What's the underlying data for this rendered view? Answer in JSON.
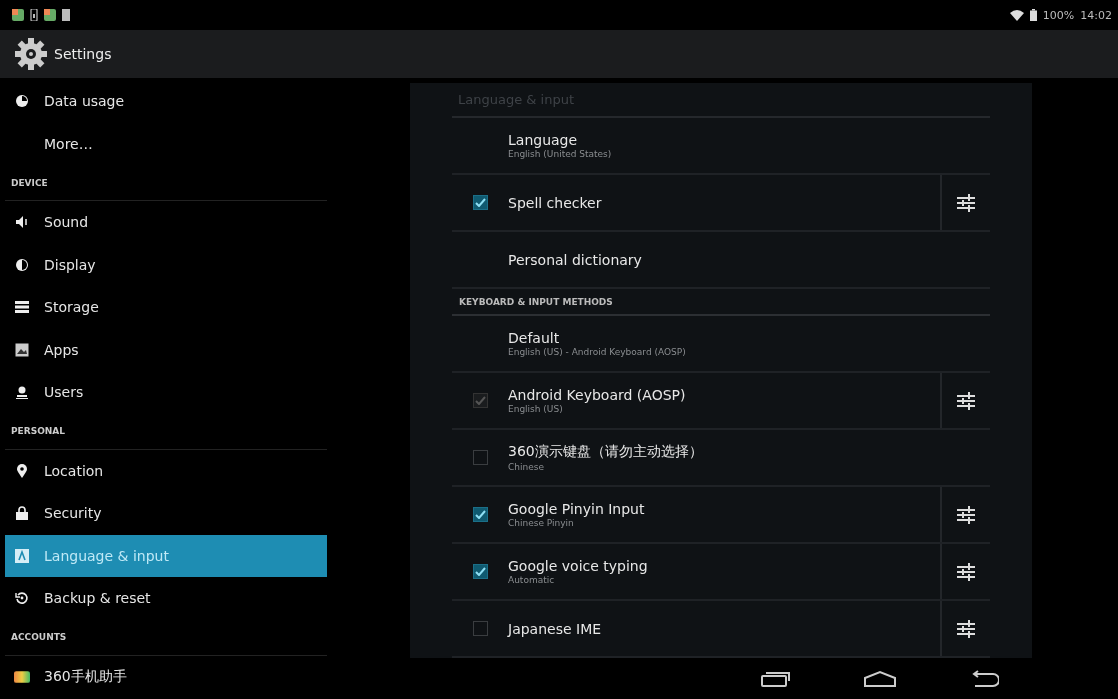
{
  "status_bar": {
    "battery": "100%",
    "time": "14:02"
  },
  "action_bar": {
    "title": "Settings"
  },
  "sidebar": {
    "items": [
      {
        "kind": "item",
        "label": "Data usage",
        "selected": false
      },
      {
        "kind": "item",
        "label": "More…",
        "selected": false
      },
      {
        "kind": "header",
        "label": "DEVICE"
      },
      {
        "kind": "item",
        "label": "Sound",
        "selected": false
      },
      {
        "kind": "item",
        "label": "Display",
        "selected": false
      },
      {
        "kind": "item",
        "label": "Storage",
        "selected": false
      },
      {
        "kind": "item",
        "label": "Apps",
        "selected": false
      },
      {
        "kind": "item",
        "label": "Users",
        "selected": false
      },
      {
        "kind": "header",
        "label": "PERSONAL"
      },
      {
        "kind": "item",
        "label": "Location",
        "selected": false
      },
      {
        "kind": "item",
        "label": "Security",
        "selected": false
      },
      {
        "kind": "item",
        "label": "Language & input",
        "selected": true
      },
      {
        "kind": "item",
        "label": "Backup & reset",
        "selected": false
      },
      {
        "kind": "header",
        "label": "ACCOUNTS"
      },
      {
        "kind": "item",
        "label": "360手机助手",
        "selected": false
      }
    ]
  },
  "panel": {
    "title": "Language & input",
    "rows": [
      {
        "kind": "plain",
        "title": "Language",
        "summary": "English (United States)"
      },
      {
        "kind": "check",
        "title": "Spell checker",
        "checked": true,
        "disabled": false,
        "settings": true
      },
      {
        "kind": "plain",
        "title": "Personal dictionary"
      },
      {
        "kind": "header",
        "title": "KEYBOARD & INPUT METHODS"
      },
      {
        "kind": "plain",
        "title": "Default",
        "summary": "English (US) - Android Keyboard (AOSP)"
      },
      {
        "kind": "check",
        "title": "Android Keyboard (AOSP)",
        "summary": "English (US)",
        "checked": true,
        "disabled": true,
        "settings": true
      },
      {
        "kind": "check",
        "title": "360演示键盘（请勿主动选择）",
        "summary": "Chinese",
        "checked": false,
        "disabled": false,
        "settings": false
      },
      {
        "kind": "check",
        "title": "Google Pinyin Input",
        "summary": "Chinese Pinyin",
        "checked": true,
        "disabled": false,
        "settings": true
      },
      {
        "kind": "check",
        "title": "Google voice typing",
        "summary": "Automatic",
        "checked": true,
        "disabled": false,
        "settings": true
      },
      {
        "kind": "check",
        "title": "Japanese IME",
        "checked": false,
        "disabled": false,
        "settings": true
      }
    ]
  }
}
